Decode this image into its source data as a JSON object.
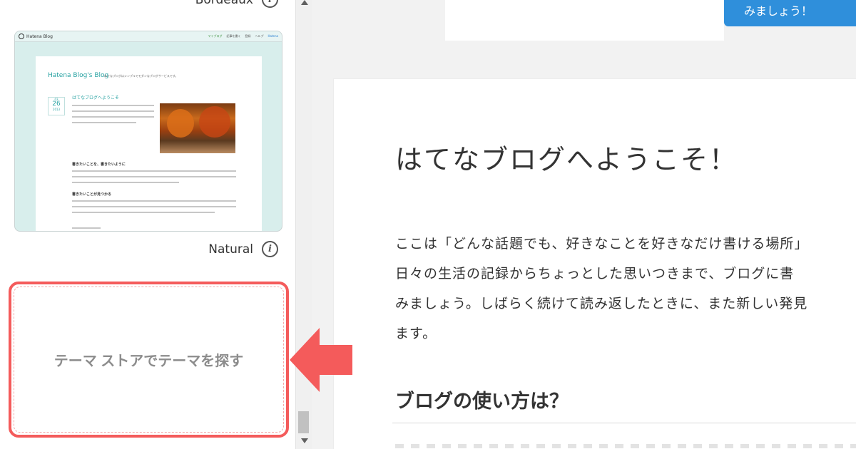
{
  "sidebar": {
    "theme_above": "Bordeaux",
    "theme_current": "Natural",
    "store_button_label": "テーマ ストアでテーマを探す",
    "thumbnail": {
      "brand": "Hatena Blog",
      "nav_items": [
        "マイブログ",
        "記事を書く",
        "登録",
        "ヘルプ"
      ],
      "nav_right": "Hatena",
      "blog_title": "Hatena Blog's Blog",
      "blog_subtitle": "はてなブログはシンプルでモダンなブログサービスです。",
      "date_month": "03",
      "date_day": "26",
      "date_year": "2013",
      "post_title": "はてなブログへようこそ",
      "heading_1": "書きたいことを、書きたいように",
      "heading_2": "書きたいことが見つかる"
    }
  },
  "header": {
    "blue_button_label": "みましょう！"
  },
  "article": {
    "title": "はてなブログへようこそ！",
    "paragraph_lines": [
      "ここは「どんな話題でも、好きなことを好きなだけ書ける場所」",
      "日々の生活の記録からちょっとした思いつきまで、ブログに書",
      "みましょう。しばらく続けて読み返したときに、また新しい発見",
      "ます。"
    ],
    "section_heading": "ブログの使い方は？"
  },
  "colors": {
    "highlight_red": "#f45b5b",
    "accent_blue": "#2f8fdb",
    "teal": "#2aa3a3"
  },
  "icons": [
    "info-icon",
    "arrow-left-icon",
    "scroll-up-icon",
    "scroll-down-icon"
  ]
}
